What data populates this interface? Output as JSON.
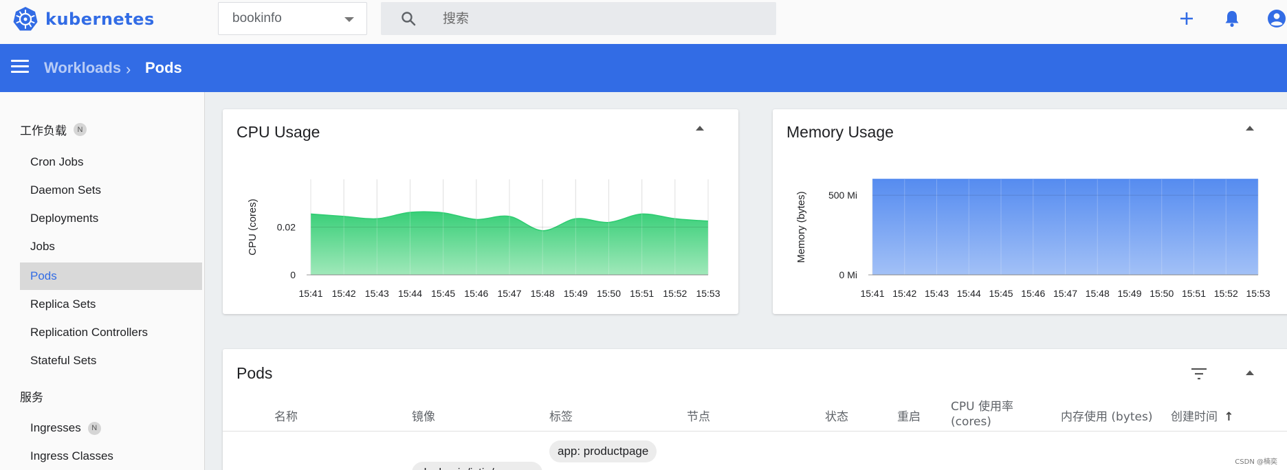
{
  "app": {
    "name": "kubernetes"
  },
  "toolbar": {
    "namespace": "bookinfo",
    "search_placeholder": "搜索"
  },
  "breadcrumb": {
    "parent": "Workloads",
    "separator": "›",
    "current": "Pods"
  },
  "sidebar": {
    "group_workloads": {
      "label": "工作负载",
      "badge": "N"
    },
    "workload_items": [
      {
        "label": "Cron Jobs"
      },
      {
        "label": "Daemon Sets"
      },
      {
        "label": "Deployments"
      },
      {
        "label": "Jobs"
      },
      {
        "label": "Pods",
        "active": true
      },
      {
        "label": "Replica Sets"
      },
      {
        "label": "Replication Controllers"
      },
      {
        "label": "Stateful Sets"
      }
    ],
    "group_service": {
      "label": "服务"
    },
    "service_items": [
      {
        "label": "Ingresses",
        "badge": "N"
      },
      {
        "label": "Ingress Classes"
      }
    ]
  },
  "cpu_card": {
    "title": "CPU Usage"
  },
  "memory_card": {
    "title": "Memory Usage"
  },
  "chart_data": [
    {
      "type": "area",
      "title": "CPU Usage",
      "ylabel": "CPU (cores)",
      "x": [
        "15:41",
        "15:42",
        "15:43",
        "15:44",
        "15:45",
        "15:46",
        "15:47",
        "15:48",
        "15:49",
        "15:50",
        "15:51",
        "15:52",
        "15:53"
      ],
      "yticks": [
        "0",
        "0.02"
      ],
      "ylim": [
        0,
        0.04
      ],
      "values": [
        0.0255,
        0.0245,
        0.0235,
        0.0262,
        0.026,
        0.0232,
        0.0245,
        0.0185,
        0.0235,
        0.022,
        0.0255,
        0.0235,
        0.0225
      ],
      "color": "#2ecc71"
    },
    {
      "type": "area",
      "title": "Memory Usage",
      "ylabel": "Memory (bytes)",
      "x": [
        "15:41",
        "15:42",
        "15:43",
        "15:44",
        "15:45",
        "15:46",
        "15:47",
        "15:48",
        "15:49",
        "15:50",
        "15:51",
        "15:52",
        "15:53"
      ],
      "yticks": [
        "0 Mi",
        "500 Mi"
      ],
      "ylim": [
        0,
        600
      ],
      "values": [
        600,
        600,
        600,
        600,
        600,
        600,
        600,
        600,
        600,
        600,
        600,
        600,
        600
      ],
      "color": "#4d86ef"
    }
  ],
  "pods": {
    "title": "Pods",
    "columns": {
      "name": "名称",
      "image": "镜像",
      "labels": "标签",
      "node": "节点",
      "status": "状态",
      "restarts": "重启",
      "cpu": "CPU 使用率 (cores)",
      "memory": "内存使用 (bytes)",
      "created": "创建时间",
      "sort_arrow": "↑"
    },
    "row_chips": {
      "label": "app: productpage",
      "image": "docker.io/istio/exam"
    }
  },
  "watermark": "CSDN @楠奕",
  "colors": {
    "brand": "#326ce5",
    "cpu_fill": "#2ecc71",
    "memory_fill": "#4d86ef"
  }
}
